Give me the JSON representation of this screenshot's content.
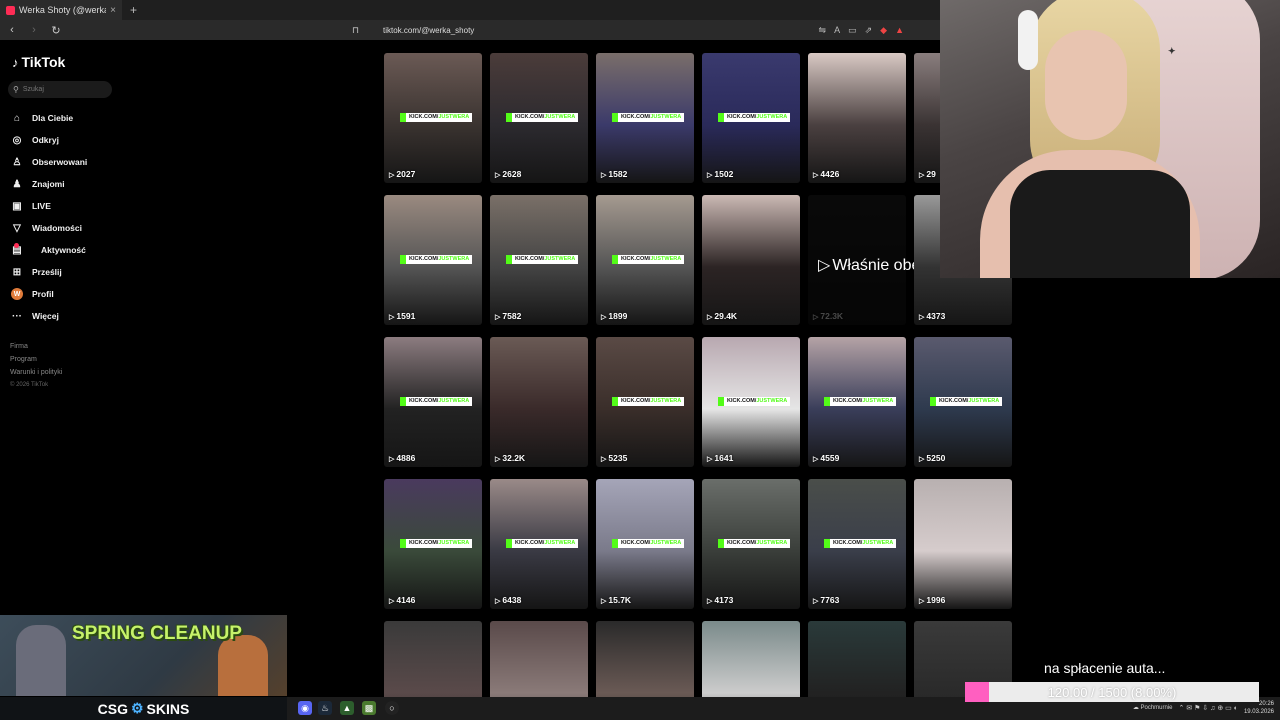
{
  "browser": {
    "tab_title": "Werka Shoty (@werka_shoty) | T",
    "tab_close": "×",
    "new_tab": "+",
    "back": "‹",
    "forward": "›",
    "reload": "↻",
    "url": "tiktok.com/@werka_shoty"
  },
  "tiktok": {
    "logo": "TikTok",
    "search_placeholder": "Szukaj",
    "menu": [
      {
        "label": "Dla Ciebie",
        "icon": "home-icon",
        "glyph": "⌂"
      },
      {
        "label": "Odkryj",
        "icon": "compass-icon",
        "glyph": "◎"
      },
      {
        "label": "Obserwowani",
        "icon": "following-icon",
        "glyph": "♙"
      },
      {
        "label": "Znajomi",
        "icon": "friends-icon",
        "glyph": "♟"
      },
      {
        "label": "LIVE",
        "icon": "live-icon",
        "glyph": "▣"
      },
      {
        "label": "Wiadomości",
        "icon": "messages-icon",
        "glyph": "▽"
      },
      {
        "label": "Aktywność",
        "icon": "activity-icon",
        "glyph": "▤"
      },
      {
        "label": "Prześlij",
        "icon": "upload-icon",
        "glyph": "⊞"
      },
      {
        "label": "Profil",
        "icon": "profile-avatar",
        "glyph": "W"
      },
      {
        "label": "Więcej",
        "icon": "more-icon",
        "glyph": "···"
      }
    ],
    "footer": {
      "firma": "Firma",
      "program": "Program",
      "warunki": "Warunki i polityki",
      "copyright": "© 2026 TikTok"
    },
    "kick_prefix": "KICK.COM/",
    "kick_user": "JUSTWERA",
    "watched_label": "Właśnie obejrzane",
    "play_glyph": "▷",
    "videos": [
      [
        "2027",
        "2628",
        "1582",
        "1502",
        "4426",
        "29"
      ],
      [
        "1591",
        "7582",
        "1899",
        "29.4K",
        "72.3K",
        "4373"
      ],
      [
        "4886",
        "32.2K",
        "5235",
        "1641",
        "4559",
        "5250"
      ],
      [
        "4146",
        "6438",
        "15.7K",
        "4173",
        "7763",
        "1996"
      ],
      [
        "",
        "",
        "",
        "",
        "",
        ""
      ]
    ]
  },
  "overlay": {
    "promo_title": "SPRING CLEANUP",
    "csg_left": "CSG",
    "csg_right": "SKINS",
    "goal_label": "na spłacenie auta...",
    "goal_text": "120.00 / 1500 (8.00%)",
    "goal_fraction": 0.08,
    "weather": "Pochmurnie",
    "clock_time": "20:26",
    "clock_date": "19.03.2026"
  }
}
